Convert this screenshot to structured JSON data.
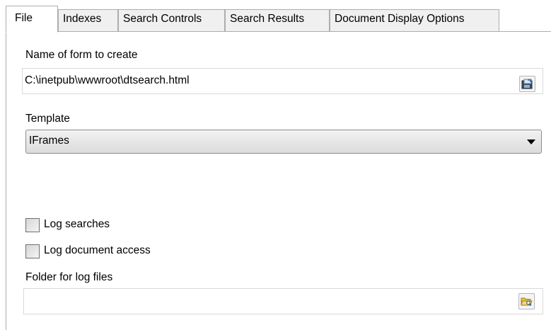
{
  "tabs": [
    {
      "label": "File",
      "active": true
    },
    {
      "label": "Indexes",
      "active": false
    },
    {
      "label": "Search Controls",
      "active": false
    },
    {
      "label": "Search Results",
      "active": false
    },
    {
      "label": "Document Display Options",
      "active": false
    }
  ],
  "form": {
    "name_label": "Name of form to create",
    "name_value": "C:\\inetpub\\wwwroot\\dtsearch.html",
    "template_label": "Template",
    "template_value": "IFrames",
    "log_searches_label": "Log searches",
    "log_searches_checked": false,
    "log_access_label": "Log document access",
    "log_access_checked": false,
    "log_folder_label": "Folder for log files",
    "log_folder_value": ""
  },
  "icons": {
    "name_browse": "save-file-icon",
    "folder_browse": "folder-open-icon"
  }
}
